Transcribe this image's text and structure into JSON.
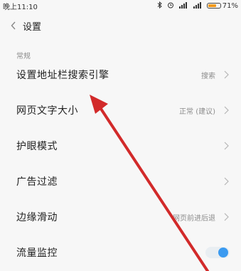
{
  "status": {
    "time": "晚上11:10",
    "battery_percent": "71%",
    "battery_level": 0.71
  },
  "header": {
    "back_icon": "chevron-left-icon",
    "title": "设置"
  },
  "section": {
    "label": "常规"
  },
  "rows": [
    {
      "label": "设置地址栏搜索引擎",
      "value": "搜索"
    },
    {
      "label": "网页文字大小",
      "value": "正常 (建议)"
    },
    {
      "label": "护眼模式",
      "value": ""
    },
    {
      "label": "广告过滤",
      "value": ""
    },
    {
      "label": "边缘滑动",
      "value": "网页前进后退"
    },
    {
      "label": "流量监控",
      "value": ""
    }
  ],
  "toggle_state": "on",
  "colors": {
    "accent": "#3b9af0",
    "annotation_arrow": "#d22a2a",
    "battery": "#f39a1e"
  }
}
